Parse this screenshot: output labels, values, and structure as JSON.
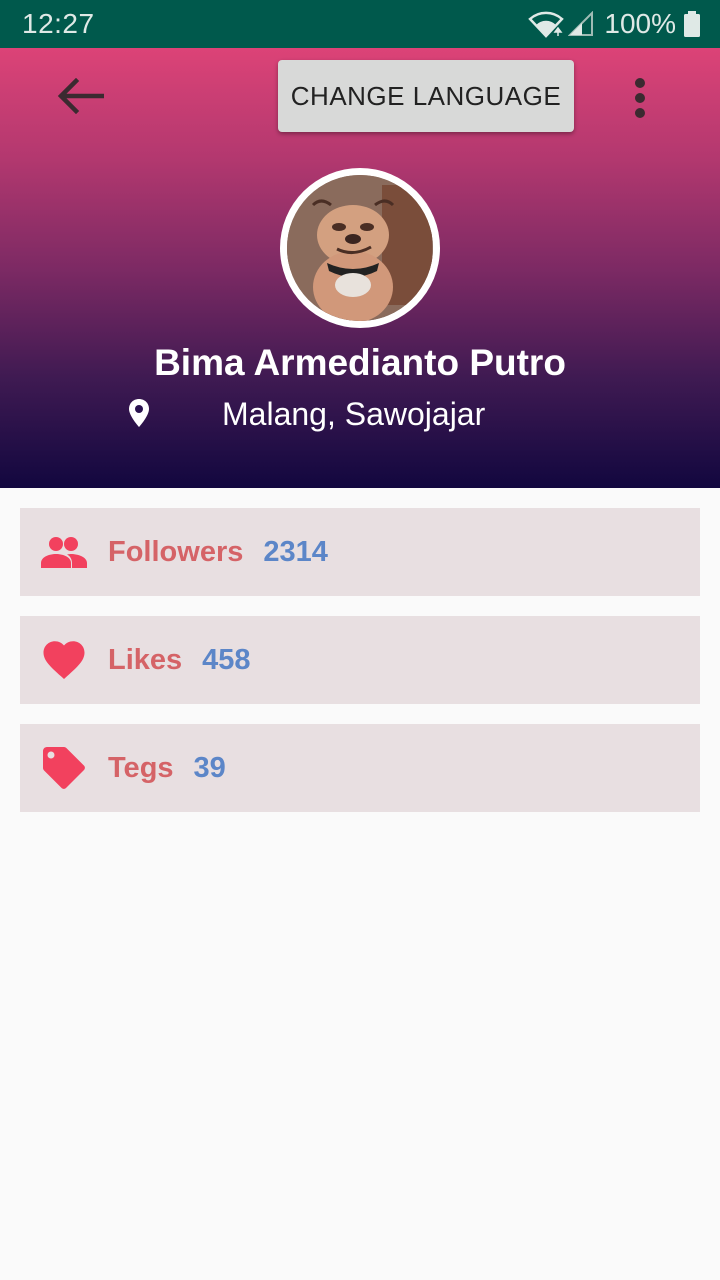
{
  "status_bar": {
    "time": "12:27",
    "battery": "100%",
    "icons": [
      "wifi-icon",
      "signal-icon",
      "battery-icon"
    ]
  },
  "toolbar": {
    "back_icon": "arrow-left-icon",
    "change_language_label": "CHANGE LANGUAGE",
    "menu_icon": "more-vertical-icon"
  },
  "profile": {
    "name": "Bima Armedianto Putro",
    "location": "Malang, Sawojajar",
    "location_icon": "map-pin-icon",
    "avatar": "avatar"
  },
  "stats": [
    {
      "label": "Followers",
      "value": "2314",
      "icon": "people-icon"
    },
    {
      "label": "Likes",
      "value": "458",
      "icon": "heart-icon"
    },
    {
      "label": "Tegs",
      "value": "39",
      "icon": "tag-icon"
    }
  ],
  "colors": {
    "status_bar": "#00594c",
    "gradient_top": "#dc4377",
    "gradient_bottom": "#12073f",
    "icon_accent": "#f2415e",
    "label": "#d56367",
    "value": "#5c86c8",
    "card_bg": "#e8dfe1"
  }
}
